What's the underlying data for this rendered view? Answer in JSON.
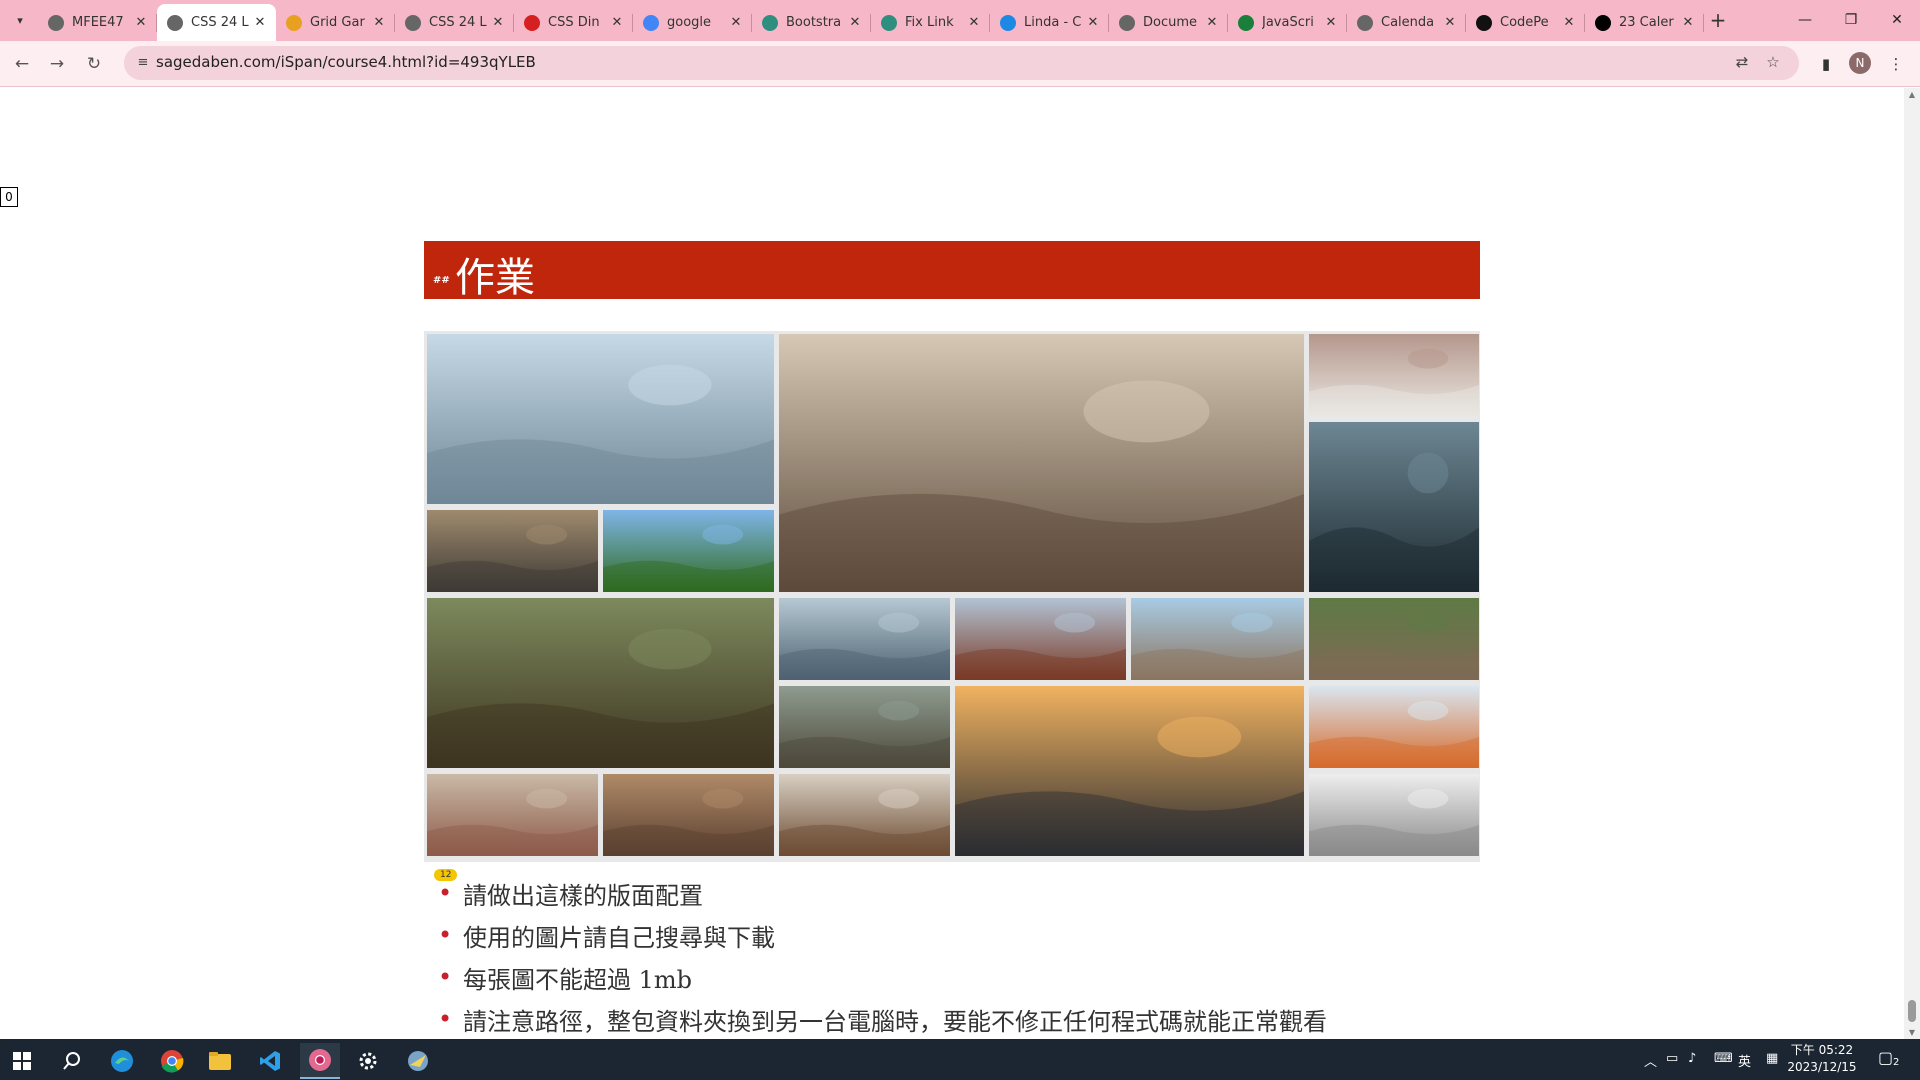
{
  "browser": {
    "tabs": [
      {
        "title": "MFEE47",
        "favicon": "globe-icon",
        "active": false
      },
      {
        "title": "CSS 24 L",
        "favicon": "globe-icon",
        "active": true
      },
      {
        "title": "Grid Gar",
        "favicon": "carrot-icon",
        "active": false
      },
      {
        "title": "CSS 24 L",
        "favicon": "globe-icon",
        "active": false
      },
      {
        "title": "CSS Din",
        "favicon": "red-logo-icon",
        "active": false
      },
      {
        "title": "google",
        "favicon": "google-icon",
        "active": false
      },
      {
        "title": "Bootstra",
        "favicon": "openai-icon",
        "active": false
      },
      {
        "title": "Fix Link",
        "favicon": "openai-icon",
        "active": false
      },
      {
        "title": "Linda - C",
        "favicon": "drive-icon",
        "active": false
      },
      {
        "title": "Docume",
        "favicon": "globe-icon",
        "active": false
      },
      {
        "title": "JavaScri",
        "favicon": "w-logo-icon",
        "active": false
      },
      {
        "title": "Calenda",
        "favicon": "globe-icon",
        "active": false
      },
      {
        "title": "CodePe",
        "favicon": "codepen-icon",
        "active": false
      },
      {
        "title": "23 Caler",
        "favicon": "medium-icon",
        "active": false
      }
    ],
    "url": "sagedaben.com/iSpan/course4.html?id=493qYLEB",
    "profile_initial": "N"
  },
  "page": {
    "slide_number": "0",
    "heading_prefix": "##",
    "heading": "作業",
    "badge": "12",
    "bullets": [
      "請做出這樣的版面配置",
      "使用的圖片請自己搜尋與下載",
      "每張圖不能超過 1mb",
      "請注意路徑，整包資料夾換到另一台電腦時，要能不修正任何程式碼就能正常觀看"
    ],
    "gallery": [
      {
        "name": "photo-hot-spring",
        "c1": "#c7d9e6",
        "c2": "#6f8796"
      },
      {
        "name": "photo-cafe-man",
        "c1": "#d6c8b5",
        "c2": "#5d4a3a"
      },
      {
        "name": "photo-white-jeep",
        "c1": "#b5978c",
        "c2": "#e9e7e2"
      },
      {
        "name": "photo-plane-wreck",
        "c1": "#6d8794",
        "c2": "#1d2a30"
      },
      {
        "name": "photo-rocky-shore",
        "c1": "#9f8a6e",
        "c2": "#3e3a35"
      },
      {
        "name": "photo-orange-tree",
        "c1": "#7fb5e6",
        "c2": "#2f6a1e"
      },
      {
        "name": "photo-forest",
        "c1": "#7d8a5d",
        "c2": "#3d3420"
      },
      {
        "name": "photo-mountain-clouds",
        "c1": "#b6c8d3",
        "c2": "#4d6170"
      },
      {
        "name": "photo-bridge",
        "c1": "#b2c3d4",
        "c2": "#7a3a26"
      },
      {
        "name": "photo-pier",
        "c1": "#a8cbe4",
        "c2": "#8b7560"
      },
      {
        "name": "photo-city-street",
        "c1": "#5e7a45",
        "c2": "#7f6a55"
      },
      {
        "name": "photo-volcano",
        "c1": "#8e9c8f",
        "c2": "#4d4a3b"
      },
      {
        "name": "photo-train-station",
        "c1": "#f0b260",
        "c2": "#2a2c31"
      },
      {
        "name": "photo-sand-dune",
        "c1": "#d9e6f0",
        "c2": "#d66b2b"
      },
      {
        "name": "photo-desk-items",
        "c1": "#c9b9a6",
        "c2": "#8e5a4a"
      },
      {
        "name": "photo-leather-keys",
        "c1": "#b08a68",
        "c2": "#5a4030"
      },
      {
        "name": "photo-dont-stand-there",
        "c1": "#d8cfc2",
        "c2": "#6d4c33"
      },
      {
        "name": "photo-speaker",
        "c1": "#eeeeee",
        "c2": "#8a8a8a"
      }
    ]
  },
  "taskbar": {
    "apps": [
      "windows-start-icon",
      "search-icon",
      "edge-icon",
      "chrome-icon",
      "file-explorer-icon",
      "vscode-icon",
      "chrome-profile-icon",
      "settings-icon",
      "app-icon"
    ],
    "ime": "英",
    "time": "下午 05:22",
    "date": "2023/12/15",
    "notifications": "2"
  }
}
